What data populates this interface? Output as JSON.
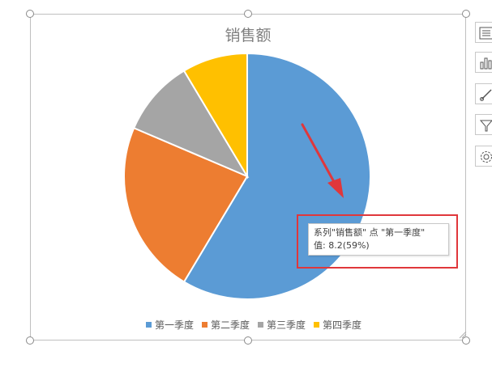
{
  "chart_data": {
    "type": "pie",
    "title": "销售额",
    "categories": [
      "第一季度",
      "第二季度",
      "第三季度",
      "第四季度"
    ],
    "values": [
      8.2,
      3.2,
      1.4,
      1.2
    ],
    "colors": [
      "#5b9bd5",
      "#ed7d31",
      "#a5a5a5",
      "#ffc000"
    ],
    "legend_position": "bottom"
  },
  "tooltip": {
    "line1": "系列\"销售额\" 点 \"第一季度\"",
    "line2": "值: 8.2(59%)"
  },
  "annotation": {
    "color": "#e0373b"
  },
  "side_toolbar": [
    {
      "name": "chart-elements-icon"
    },
    {
      "name": "chart-styles-icon"
    },
    {
      "name": "chart-brush-icon"
    },
    {
      "name": "chart-filter-icon"
    },
    {
      "name": "chart-settings-icon"
    }
  ]
}
